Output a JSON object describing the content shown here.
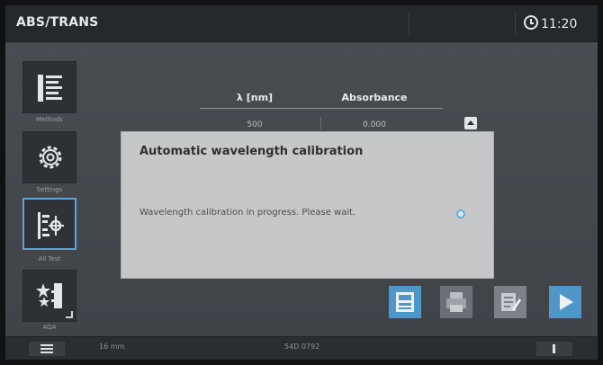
{
  "titlebar": {
    "title": "ABS/TRANS",
    "time": "11:20"
  },
  "sidebar": {
    "items": [
      {
        "name": "methods",
        "label": "Methods",
        "icon": "methods-list-icon"
      },
      {
        "name": "settings",
        "label": "Settings",
        "icon": "gear-icon"
      },
      {
        "name": "all-test",
        "label": "All Test",
        "icon": "wavelength-calibration-icon",
        "active": true
      },
      {
        "name": "aqa",
        "label": "AQA",
        "icon": "stars-icon"
      }
    ]
  },
  "table": {
    "columns": [
      "λ [nm]",
      "Absorbance"
    ],
    "rows": [
      [
        "500",
        "0.000"
      ]
    ]
  },
  "dialog": {
    "title": "Automatic wavelength calibration",
    "message": "Wavelength calibration in progress. Please wait."
  },
  "toolbar": {
    "buttons": [
      {
        "name": "save",
        "icon": "save-icon"
      },
      {
        "name": "print",
        "icon": "print-icon"
      },
      {
        "name": "edit",
        "icon": "edit-notes-icon"
      },
      {
        "name": "start",
        "icon": "play-icon"
      }
    ]
  },
  "statusbar": {
    "cuvette": "16 mm",
    "serial": "54D 0792"
  },
  "colors": {
    "accent": "#4f97c9",
    "highlight": "#5aa5d6",
    "dialog_bg": "#c6c7c8"
  }
}
